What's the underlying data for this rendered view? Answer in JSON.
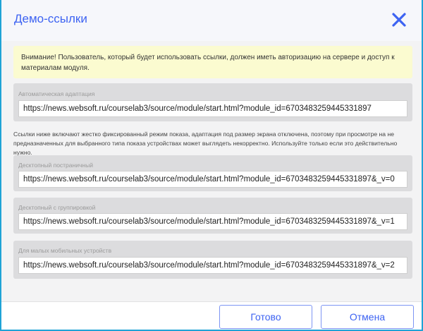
{
  "dialog": {
    "title": "Демо-ссылки",
    "close_icon": "close-x-icon"
  },
  "warning": "Внимание! Пользователь, который будет использовать ссылки, должен иметь авторизацию на сервере и доступ к материалам модуля.",
  "auto": {
    "label": "Автоматическая адаптация",
    "url": "https://news.websoft.ru/courselab3/source/module/start.html?module_id=6703483259445331897"
  },
  "note": "Ссылки ниже включают жестко фиксированный режим показа, адаптация под размер экрана отключена, поэтому при просмотре на не предназначенных для выбранного типа показа устройствах может выглядеть некорректно. Используйте только если это действительно нужно.",
  "links": [
    {
      "label": "Десктопный постраничный",
      "url": "https://news.websoft.ru/courselab3/source/module/start.html?module_id=6703483259445331897&_v=0"
    },
    {
      "label": "Десктопный с группировкой",
      "url": "https://news.websoft.ru/courselab3/source/module/start.html?module_id=6703483259445331897&_v=1"
    },
    {
      "label": "Для малых мобильных устройств",
      "url": "https://news.websoft.ru/courselab3/source/module/start.html?module_id=6703483259445331897&_v=2"
    }
  ],
  "footer": {
    "done": "Готово",
    "cancel": "Отмена"
  }
}
